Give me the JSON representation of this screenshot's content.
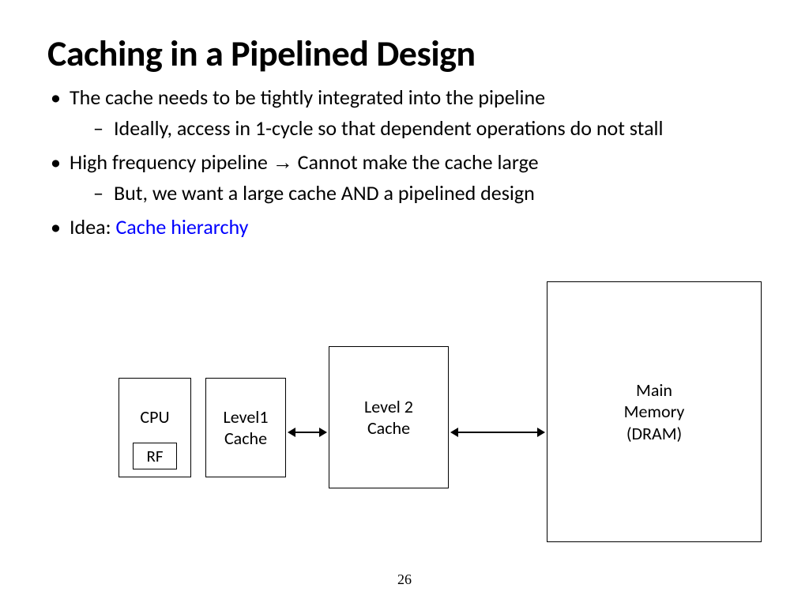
{
  "title": "Caching in a Pipelined Design",
  "bullets": {
    "b1": "The cache needs to be tightly integrated into the pipeline",
    "b1a": "Ideally, access in 1-cycle so that dependent operations do not stall",
    "b2_pre": "High frequency pipeline ",
    "b2_arrow": "→",
    "b2_post": " Cannot make the cache large",
    "b2a": "But, we want a large cache AND a pipelined design",
    "b3_pre": "Idea: ",
    "b3_blue": "Cache hierarchy"
  },
  "diagram": {
    "cpu": "CPU",
    "rf": "RF",
    "l1_line1": "Level1",
    "l1_line2": "Cache",
    "l2_line1": "Level 2",
    "l2_line2": "Cache",
    "mem_line1": "Main",
    "mem_line2": "Memory",
    "mem_line3": "(DRAM)"
  },
  "page_number": "26"
}
